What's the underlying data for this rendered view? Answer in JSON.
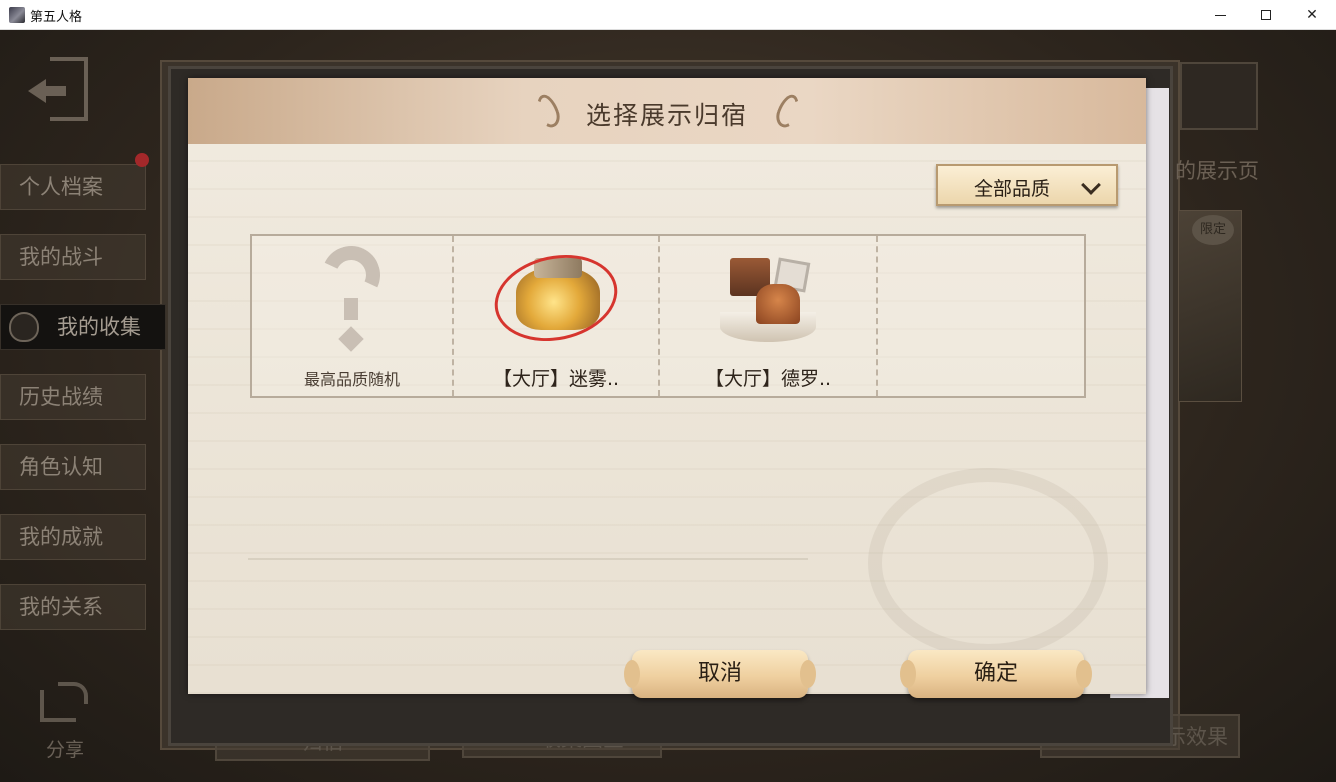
{
  "window": {
    "title": "第五人格"
  },
  "sidebar": {
    "items": [
      {
        "label": "个人档案"
      },
      {
        "label": "我的战斗"
      },
      {
        "label": "我的收集"
      },
      {
        "label": "历史战绩"
      },
      {
        "label": "角色认知"
      },
      {
        "label": "我的成就"
      },
      {
        "label": "我的关系"
      }
    ],
    "active_index": 2,
    "share_label": "分享"
  },
  "background": {
    "right_label": "的展示页",
    "badge_label": "限定",
    "tabs": {
      "guisu": "归宿",
      "collection": "收集图鉴",
      "edit": "编辑展示效果"
    }
  },
  "dialog": {
    "title": "选择展示归宿",
    "quality_filter": {
      "selected": "全部品质"
    },
    "items": [
      {
        "label": "最高品质随机",
        "icon": "question-mark-icon"
      },
      {
        "label": "【大厅】迷雾..",
        "icon": "lobby-mist-icon"
      },
      {
        "label": "【大厅】德罗..",
        "icon": "lobby-delo-icon"
      }
    ],
    "cancel_label": "取消",
    "confirm_label": "确定"
  },
  "colors": {
    "accent_red": "#d6352e",
    "button_gold": "#efd0a0",
    "paper": "#ece5d8"
  }
}
